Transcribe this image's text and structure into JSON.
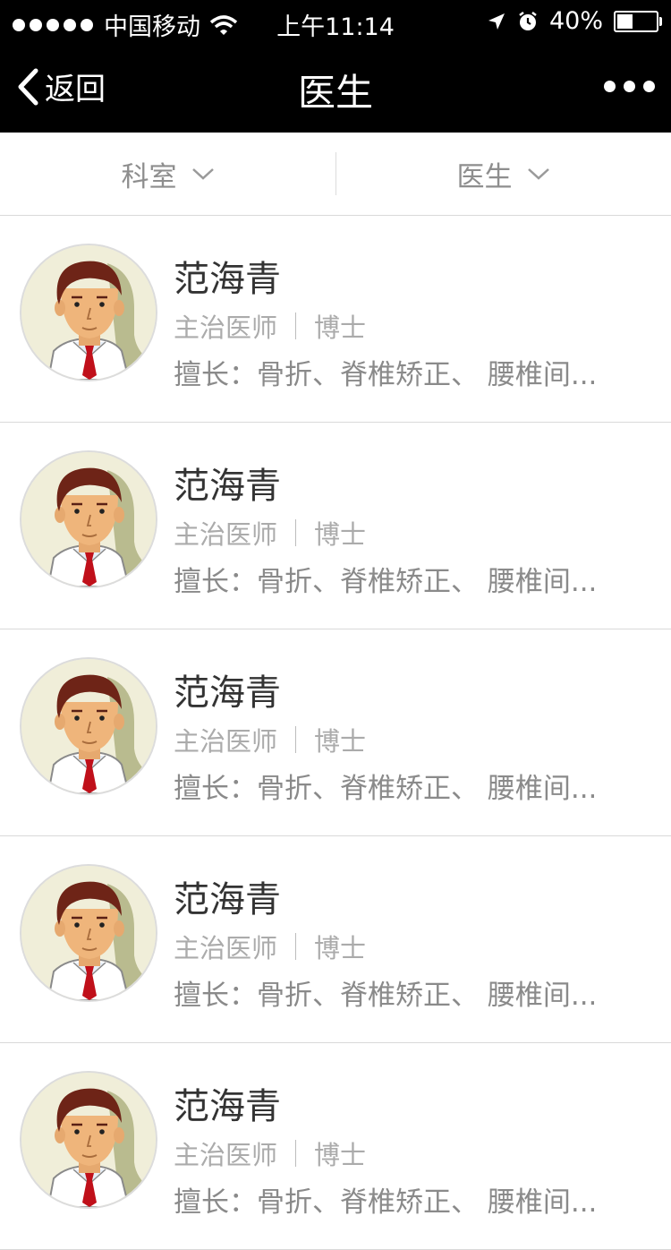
{
  "status_bar": {
    "carrier": "中国移动",
    "time": "上午11:14",
    "battery": "40%",
    "battery_level": 0.4
  },
  "navbar": {
    "back_label": "返回",
    "title": "医生"
  },
  "filters": [
    {
      "label": "科室"
    },
    {
      "label": "医生"
    }
  ],
  "doctors": [
    {
      "name": "范海青",
      "title": "主治医师",
      "degree": "博士",
      "specialty": "擅长：骨折、脊椎矫正、 腰椎间..."
    },
    {
      "name": "范海青",
      "title": "主治医师",
      "degree": "博士",
      "specialty": "擅长：骨折、脊椎矫正、 腰椎间..."
    },
    {
      "name": "范海青",
      "title": "主治医师",
      "degree": "博士",
      "specialty": "擅长：骨折、脊椎矫正、 腰椎间..."
    },
    {
      "name": "范海青",
      "title": "主治医师",
      "degree": "博士",
      "specialty": "擅长：骨折、脊椎矫正、 腰椎间..."
    },
    {
      "name": "范海青",
      "title": "主治医师",
      "degree": "博士",
      "specialty": "擅长：骨折、脊椎矫正、 腰椎间..."
    }
  ]
}
